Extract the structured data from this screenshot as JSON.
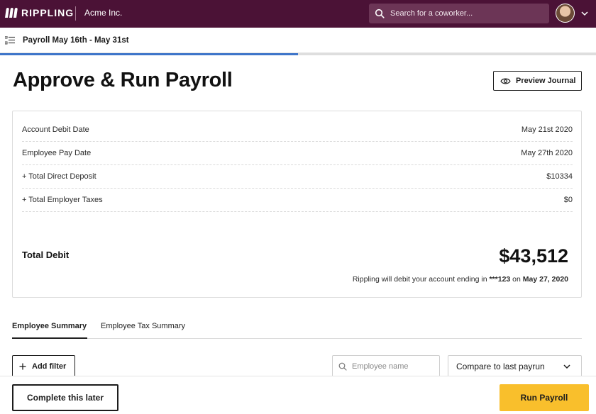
{
  "topbar": {
    "brand": "RIPPLING",
    "company": "Acme Inc.",
    "search_placeholder": "Search for a coworker...",
    "colors": {
      "nav_bg": "#4b1236",
      "search_bg": "#6c3556"
    }
  },
  "subheader": {
    "period_title": "Payroll May 16th - May 31st",
    "progress_percent": 50,
    "colors": {
      "progress": "#3e75c9"
    }
  },
  "page": {
    "title": "Approve & Run Payroll",
    "preview_label": "Preview Journal"
  },
  "summary": {
    "rows": [
      {
        "label": "Account Debit Date",
        "value": "May 21st 2020"
      },
      {
        "label": "Employee Pay Date",
        "value": "May 27th 2020"
      },
      {
        "label": "+ Total Direct Deposit",
        "value": "$10334"
      },
      {
        "label": "+ Total Employer Taxes",
        "value": "$0"
      }
    ],
    "total_label": "Total Debit",
    "total_amount": "$43,512",
    "debit_note_prefix": "Rippling will debit your account ending in",
    "account_suffix": "***123",
    "debit_note_on": "on",
    "debit_date": "May 27, 2020"
  },
  "tabs": [
    {
      "label": "Employee Summary",
      "active": true
    },
    {
      "label": "Employee Tax Summary",
      "active": false
    }
  ],
  "filters": {
    "add_filter_label": "Add filter",
    "employee_search_placeholder": "Employee name",
    "compare_value": "Compare to last payrun"
  },
  "footer": {
    "later_label": "Complete this later",
    "run_label": "Run Payroll",
    "colors": {
      "run_bg": "#f9bf2c"
    }
  }
}
